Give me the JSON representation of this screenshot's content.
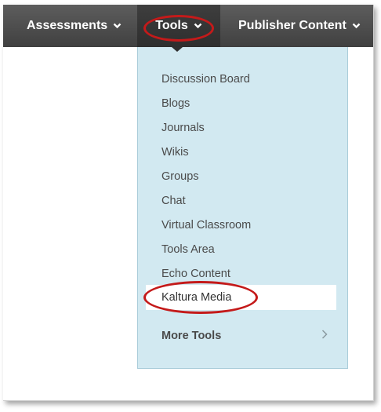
{
  "nav": {
    "items": [
      {
        "label": "Assessments"
      },
      {
        "label": "Tools"
      },
      {
        "label": "Publisher Content"
      }
    ]
  },
  "tools_menu": {
    "items": [
      {
        "label": "Discussion Board"
      },
      {
        "label": "Blogs"
      },
      {
        "label": "Journals"
      },
      {
        "label": "Wikis"
      },
      {
        "label": "Groups"
      },
      {
        "label": "Chat"
      },
      {
        "label": "Virtual Classroom"
      },
      {
        "label": "Tools Area"
      },
      {
        "label": "Echo Content"
      },
      {
        "label": "Kaltura Media"
      }
    ],
    "more_label": "More Tools"
  },
  "colors": {
    "navbar": "#4a4a4a",
    "menu_bg": "#d2e9f1",
    "highlight": "#c41a1a"
  },
  "icons": {
    "nav_dropdown": "chevron-down-icon",
    "more_tools": "chevron-right-icon"
  }
}
